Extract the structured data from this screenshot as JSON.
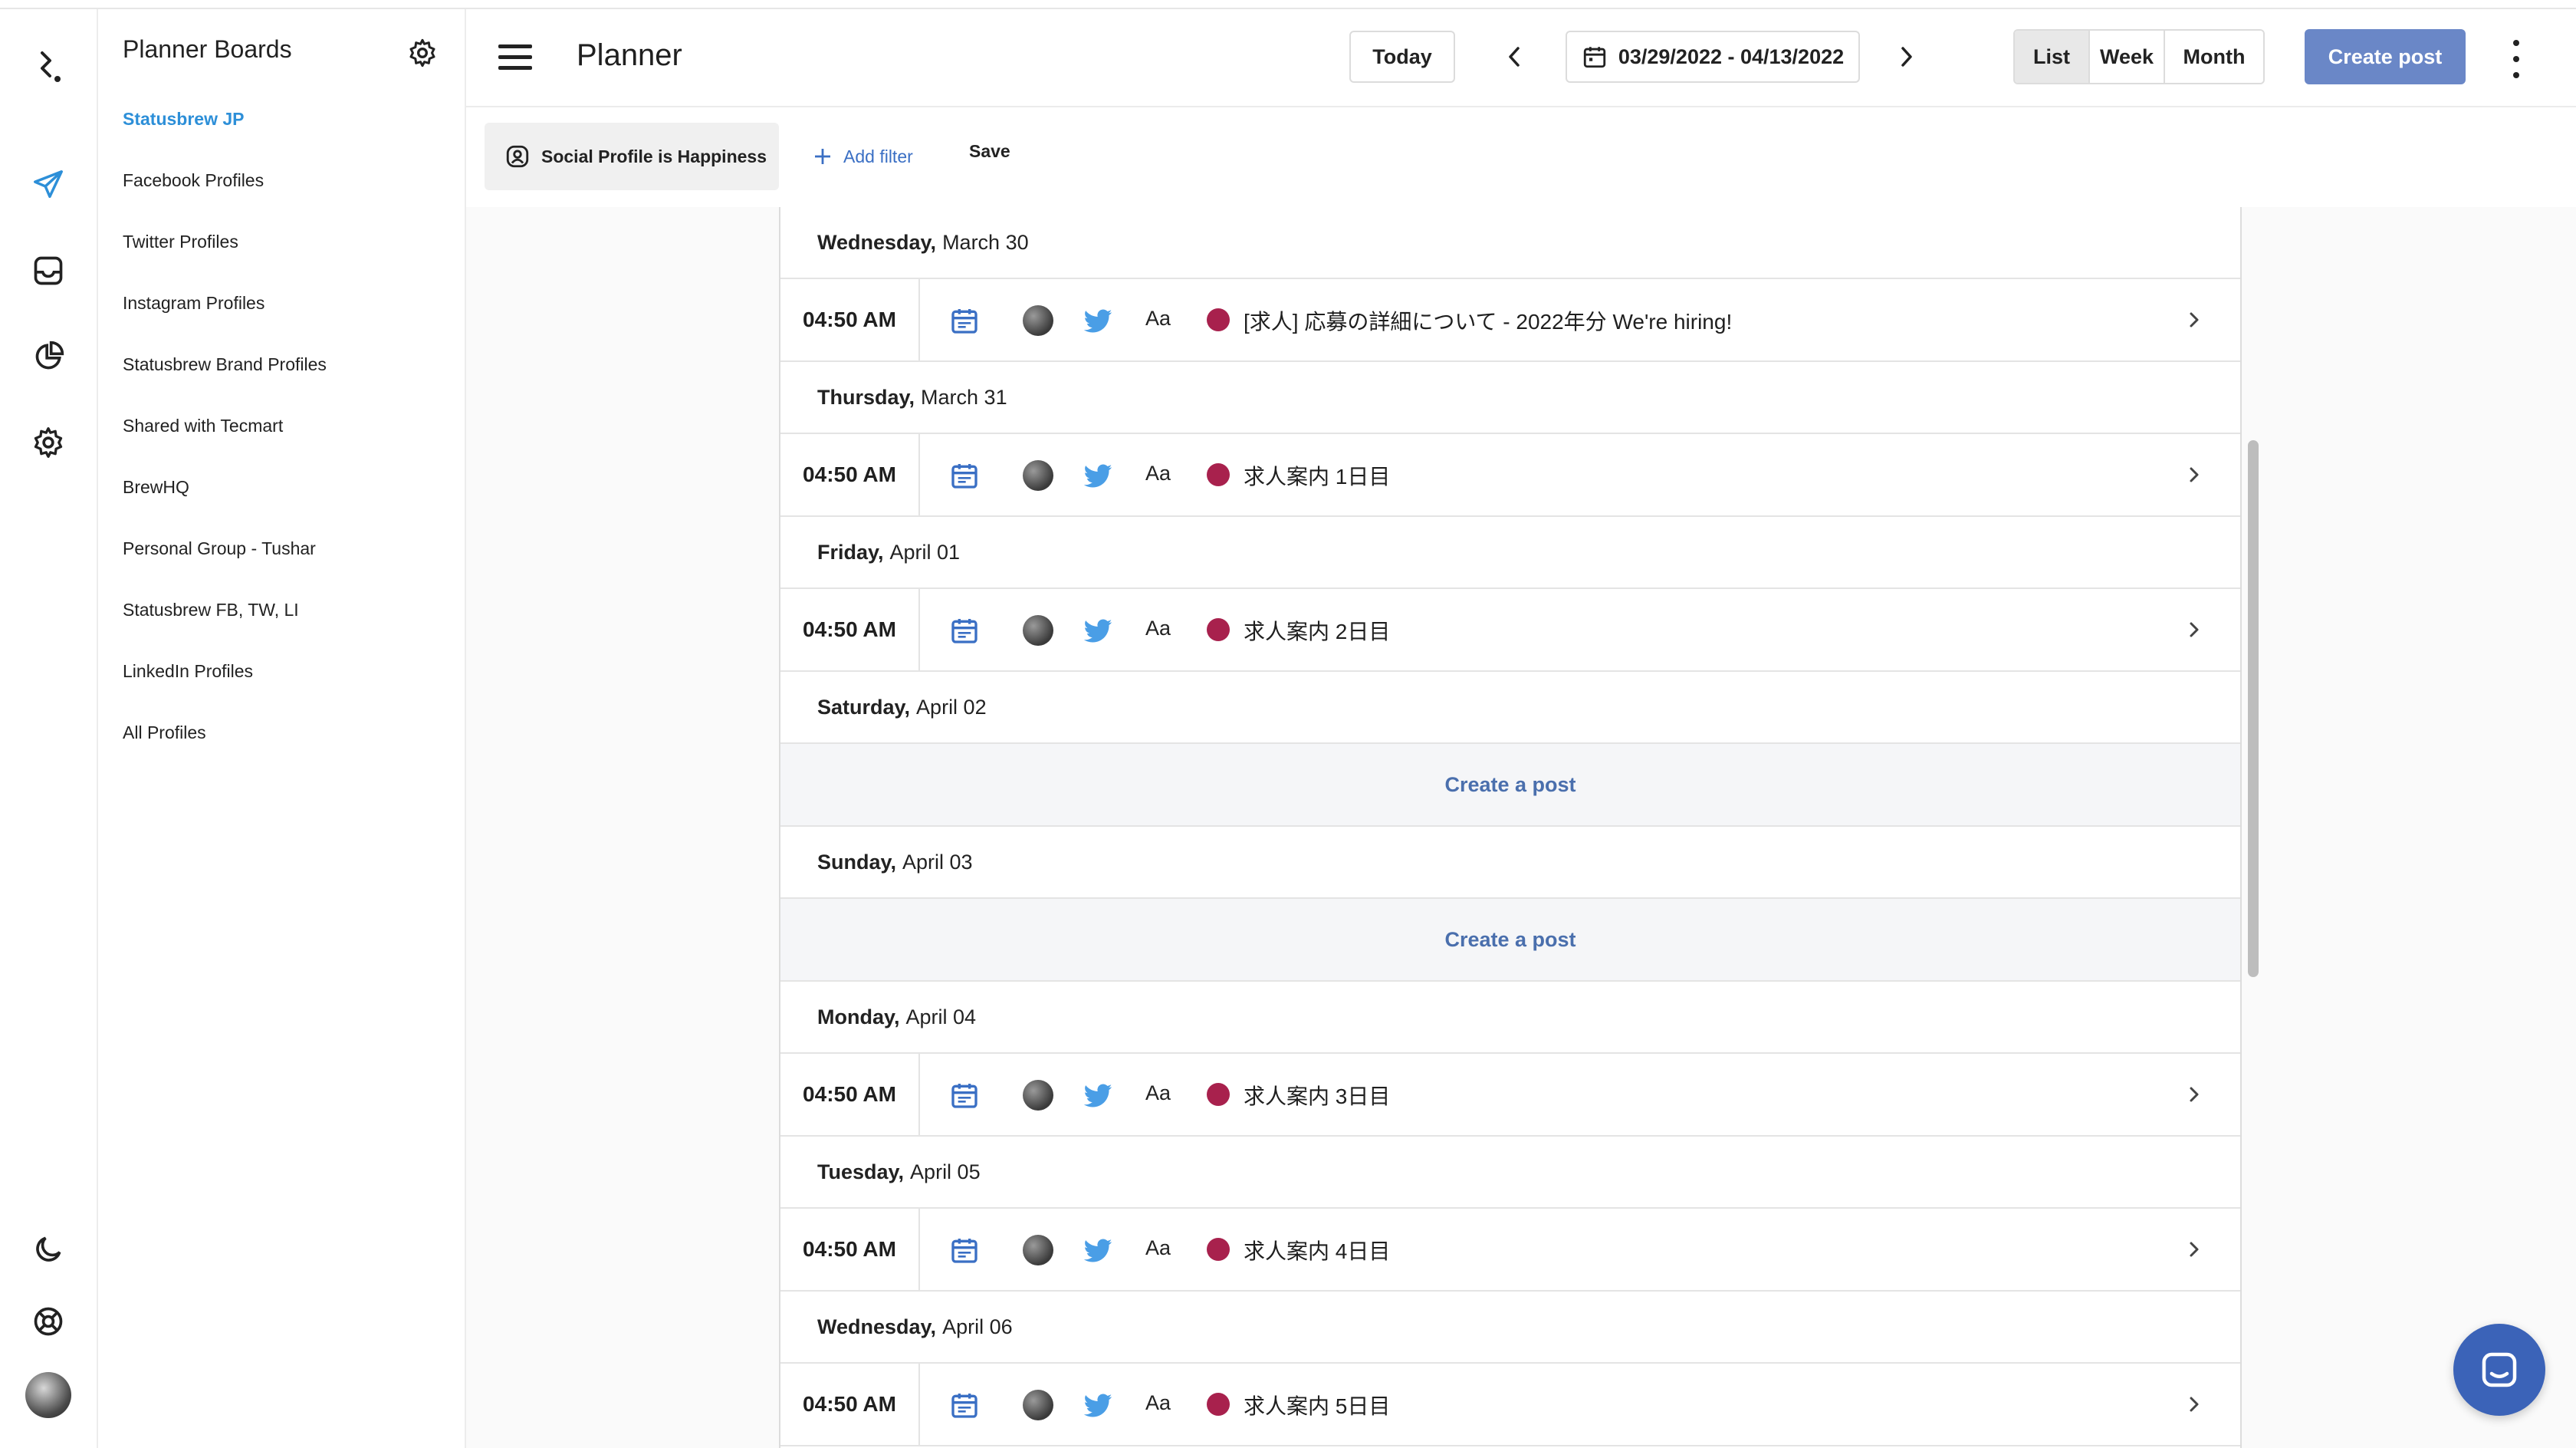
{
  "rail": {
    "icons": [
      "logo-icon",
      "publish-icon",
      "inbox-icon",
      "reports-icon",
      "settings-icon",
      "dark-mode-icon",
      "help-icon",
      "user-avatar"
    ],
    "accent": "#2d8fd8"
  },
  "boards": {
    "title": "Planner Boards",
    "items": [
      "Statusbrew JP",
      "Facebook Profiles",
      "Twitter Profiles",
      "Instagram Profiles",
      "Statusbrew Brand Profiles",
      "Shared with Tecmart",
      "BrewHQ",
      "Personal Group - Tushar",
      "Statusbrew FB, TW, LI",
      "LinkedIn Profiles",
      "All Profiles"
    ],
    "active_index": 0
  },
  "header": {
    "title": "Planner",
    "today_label": "Today",
    "date_range": "03/29/2022 - 04/13/2022",
    "views": [
      "List",
      "Week",
      "Month"
    ],
    "active_view": "List",
    "create_label": "Create post"
  },
  "filters": {
    "profile_chip": "Social Profile is Happiness",
    "add_filter_label": "Add filter",
    "save_label": "Save"
  },
  "timeline": {
    "empty_label": "Create a post",
    "days": [
      {
        "weekday": "Wednesday,",
        "date": "March 30",
        "post": {
          "time": "04:50 AM",
          "text": "[求人] 応募の詳細について - 2022年分 We're hiring!"
        }
      },
      {
        "weekday": "Thursday,",
        "date": "March 31",
        "post": {
          "time": "04:50 AM",
          "text": "求人案内 1日目"
        }
      },
      {
        "weekday": "Friday,",
        "date": "April 01",
        "post": {
          "time": "04:50 AM",
          "text": "求人案内 2日目"
        }
      },
      {
        "weekday": "Saturday,",
        "date": "April 02",
        "post": null
      },
      {
        "weekday": "Sunday,",
        "date": "April 03",
        "post": null
      },
      {
        "weekday": "Monday,",
        "date": "April 04",
        "post": {
          "time": "04:50 AM",
          "text": "求人案内 3日目"
        }
      },
      {
        "weekday": "Tuesday,",
        "date": "April 05",
        "post": {
          "time": "04:50 AM",
          "text": "求人案内 4日目"
        }
      },
      {
        "weekday": "Wednesday,",
        "date": "April 06",
        "post": {
          "time": "04:50 AM",
          "text": "求人案内 5日目"
        }
      }
    ],
    "post_type_label": "Aa",
    "label_color": "#a8214d",
    "twitter_color": "#4a9ee6"
  },
  "colors": {
    "primary_button": "#6a87c7",
    "link": "#3a6fc4",
    "chat_button": "#3b63b8"
  }
}
